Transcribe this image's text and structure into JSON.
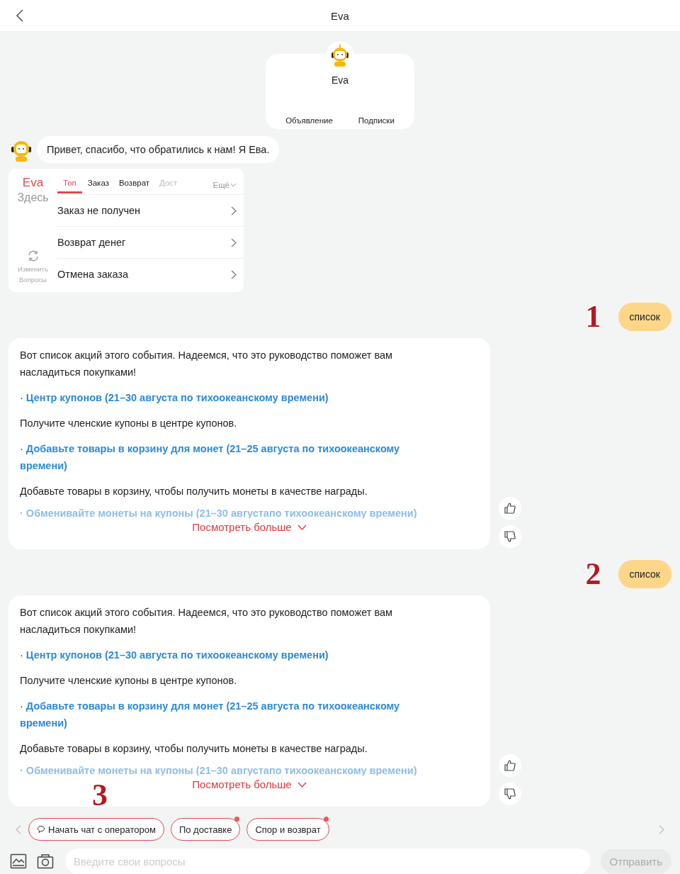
{
  "header": {
    "title": "Eva"
  },
  "profile": {
    "name": "Eva",
    "links": [
      "Объявление",
      "Подписки"
    ]
  },
  "greeting": {
    "text": "Привет, спасибо, что обратились к нам! Я Ева."
  },
  "quick": {
    "brand": "Eva",
    "subtitle": "Здесь",
    "refresh_label": "Изменить Вопросы",
    "more": "Ещё",
    "tabs": [
      {
        "label": "Топ",
        "selected": true,
        "cut": false
      },
      {
        "label": "Заказ",
        "selected": false,
        "cut": false
      },
      {
        "label": "Возврат",
        "selected": false,
        "cut": false
      },
      {
        "label": "Дост",
        "selected": false,
        "cut": true
      }
    ],
    "questions": [
      "Заказ не получен",
      "Возврат денег",
      "Отмена заказа"
    ]
  },
  "messages": [
    {
      "kind": "user",
      "text": "список",
      "step": "1"
    },
    {
      "kind": "answer",
      "more": "Посмотреть больше",
      "paragraphs": [
        {
          "kind": "text",
          "text": "Вот список акций этого события. Надеемся, что это руководство поможет вам насладиться покупками!"
        },
        {
          "kind": "link",
          "bullet": "·",
          "text": "Центр купонов (21–30 августа по тихоокеанскому времени)"
        },
        {
          "kind": "text",
          "text": "Получите членские купоны в центре купонов."
        },
        {
          "kind": "link",
          "bullet": "·",
          "text": "Добавьте товары в корзину для монет (21–25 августа по тихоокеанскому времени)"
        },
        {
          "kind": "text",
          "text": "Добавьте товары в корзину, чтобы получить монеты в качестве награды."
        },
        {
          "kind": "faded",
          "bullet": "·",
          "text": "Обменивайте монеты на купоны (21–30 августапо тихоокеанскому времени)"
        }
      ]
    },
    {
      "kind": "user",
      "text": "список",
      "step": "2"
    },
    {
      "kind": "answer",
      "more": "Посмотреть больше",
      "step": "3",
      "paragraphs": [
        {
          "kind": "text",
          "text": "Вот список акций этого события. Надеемся, что это руководство поможет вам насладиться покупками!"
        },
        {
          "kind": "link",
          "bullet": "·",
          "text": "Центр купонов (21–30 августа по тихоокеанскому времени)"
        },
        {
          "kind": "text",
          "text": "Получите членские купоны в центре купонов."
        },
        {
          "kind": "link",
          "bullet": "·",
          "text": "Добавьте товары в корзину для монет (21–25 августа по тихоокеанскому времени)"
        },
        {
          "kind": "text",
          "text": "Добавьте товары в корзину, чтобы получить монеты в качестве награды."
        },
        {
          "kind": "faded",
          "bullet": "·",
          "text": "Обменивайте монеты на купоны (21–30 августапо тихоокеанскому времени)"
        }
      ]
    }
  ],
  "chips": [
    {
      "label": "Начать чат с оператором",
      "icon": true,
      "badge": false
    },
    {
      "label": "По доставке",
      "icon": false,
      "badge": true
    },
    {
      "label": "Спор и возврат",
      "icon": false,
      "badge": true
    }
  ],
  "composer": {
    "placeholder": "Введите свои вопросы",
    "send": "Отправить"
  }
}
